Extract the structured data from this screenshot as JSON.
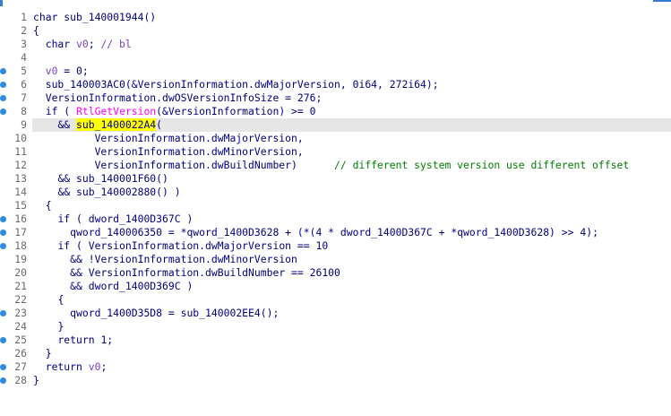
{
  "lines": [
    {
      "num": "1",
      "dot": false,
      "hl": false,
      "indent": "",
      "segments": [
        {
          "t": "char sub_140001944()",
          "c": "kw"
        }
      ]
    },
    {
      "num": "2",
      "dot": false,
      "hl": false,
      "indent": "",
      "segments": [
        {
          "t": "{",
          "c": "kw"
        }
      ]
    },
    {
      "num": "3",
      "dot": false,
      "hl": false,
      "indent": "  ",
      "segments": [
        {
          "t": "char ",
          "c": "kw"
        },
        {
          "t": "v0",
          "c": "pink"
        },
        {
          "t": "; ",
          "c": "kw"
        },
        {
          "t": "// bl",
          "c": "pink"
        }
      ]
    },
    {
      "num": "4",
      "dot": false,
      "hl": false,
      "indent": "",
      "segments": []
    },
    {
      "num": "5",
      "dot": true,
      "hl": false,
      "indent": "  ",
      "segments": [
        {
          "t": "v0",
          "c": "pink"
        },
        {
          "t": " = 0;",
          "c": "kw"
        }
      ]
    },
    {
      "num": "6",
      "dot": true,
      "hl": false,
      "indent": "  ",
      "segments": [
        {
          "t": "sub_140003AC0(&VersionInformation.dwMajorVersion, 0i64, 272i64);",
          "c": "kw"
        }
      ]
    },
    {
      "num": "7",
      "dot": true,
      "hl": false,
      "indent": "  ",
      "segments": [
        {
          "t": "VersionInformation.dwOSVersionInfoSize = 276;",
          "c": "kw"
        }
      ]
    },
    {
      "num": "8",
      "dot": true,
      "hl": false,
      "indent": "  ",
      "segments": [
        {
          "t": "if ( ",
          "c": "kw"
        },
        {
          "t": "RtlGetVersion",
          "c": "api"
        },
        {
          "t": "(&VersionInformation) >= 0",
          "c": "kw"
        }
      ]
    },
    {
      "num": "9",
      "dot": false,
      "hl": true,
      "indent": "    ",
      "segments": [
        {
          "t": "&& ",
          "c": "kw"
        },
        {
          "t": "sub_1400022A4",
          "c": "hlw"
        },
        {
          "t": "(",
          "c": "kw"
        }
      ]
    },
    {
      "num": "10",
      "dot": false,
      "hl": false,
      "indent": "          ",
      "segments": [
        {
          "t": "VersionInformation.dwMajorVersion,",
          "c": "kw"
        }
      ]
    },
    {
      "num": "11",
      "dot": false,
      "hl": false,
      "indent": "          ",
      "segments": [
        {
          "t": "VersionInformation.dwMinorVersion,",
          "c": "kw"
        }
      ]
    },
    {
      "num": "12",
      "dot": false,
      "hl": false,
      "indent": "          ",
      "segments": [
        {
          "t": "VersionInformation.dwBuildNumber)      ",
          "c": "kw"
        },
        {
          "t": "// different system version use different offset",
          "c": "cm"
        }
      ]
    },
    {
      "num": "13",
      "dot": false,
      "hl": false,
      "indent": "    ",
      "segments": [
        {
          "t": "&& sub_140001F60()",
          "c": "kw"
        }
      ]
    },
    {
      "num": "14",
      "dot": false,
      "hl": false,
      "indent": "    ",
      "segments": [
        {
          "t": "&& sub_140002880() )",
          "c": "kw"
        }
      ]
    },
    {
      "num": "15",
      "dot": false,
      "hl": false,
      "indent": "  ",
      "segments": [
        {
          "t": "{",
          "c": "kw"
        }
      ]
    },
    {
      "num": "16",
      "dot": true,
      "hl": false,
      "indent": "    ",
      "segments": [
        {
          "t": "if ( dword_1400D367C )",
          "c": "kw"
        }
      ]
    },
    {
      "num": "17",
      "dot": true,
      "hl": false,
      "indent": "      ",
      "segments": [
        {
          "t": "qword_140006350 = *qword_1400D3628 + (*(4 * dword_1400D367C + *qword_1400D3628) >> 4);",
          "c": "kw"
        }
      ]
    },
    {
      "num": "18",
      "dot": true,
      "hl": false,
      "indent": "    ",
      "segments": [
        {
          "t": "if ( VersionInformation.dwMajorVersion == 10",
          "c": "kw"
        }
      ]
    },
    {
      "num": "19",
      "dot": false,
      "hl": false,
      "indent": "      ",
      "segments": [
        {
          "t": "&& !VersionInformation.dwMinorVersion",
          "c": "kw"
        }
      ]
    },
    {
      "num": "20",
      "dot": false,
      "hl": false,
      "indent": "      ",
      "segments": [
        {
          "t": "&& VersionInformation.dwBuildNumber == 26100",
          "c": "kw"
        }
      ]
    },
    {
      "num": "21",
      "dot": false,
      "hl": false,
      "indent": "      ",
      "segments": [
        {
          "t": "&& dword_1400D369C )",
          "c": "kw"
        }
      ]
    },
    {
      "num": "22",
      "dot": false,
      "hl": false,
      "indent": "    ",
      "segments": [
        {
          "t": "{",
          "c": "kw"
        }
      ]
    },
    {
      "num": "23",
      "dot": true,
      "hl": false,
      "indent": "      ",
      "segments": [
        {
          "t": "qword_1400D35D8 = sub_140002EE4();",
          "c": "kw"
        }
      ]
    },
    {
      "num": "24",
      "dot": false,
      "hl": false,
      "indent": "    ",
      "segments": [
        {
          "t": "}",
          "c": "kw"
        }
      ]
    },
    {
      "num": "25",
      "dot": true,
      "hl": false,
      "indent": "    ",
      "segments": [
        {
          "t": "return 1;",
          "c": "kw"
        }
      ]
    },
    {
      "num": "26",
      "dot": false,
      "hl": false,
      "indent": "  ",
      "segments": [
        {
          "t": "}",
          "c": "kw"
        }
      ]
    },
    {
      "num": "27",
      "dot": true,
      "hl": false,
      "indent": "  ",
      "segments": [
        {
          "t": "return ",
          "c": "kw"
        },
        {
          "t": "v0",
          "c": "pink"
        },
        {
          "t": ";",
          "c": "kw"
        }
      ]
    },
    {
      "num": "28",
      "dot": true,
      "hl": false,
      "indent": "",
      "segments": [
        {
          "t": "}",
          "c": "kw"
        }
      ]
    }
  ],
  "colors": {
    "breakpoint_dot": "#2f8be0",
    "highlight_word": "#ffff00",
    "current_line": "#e6e6e6",
    "comment": "#008000",
    "api_call": "#ff00ff",
    "local_var": "#7a3fbf",
    "code_text": "#000080"
  }
}
